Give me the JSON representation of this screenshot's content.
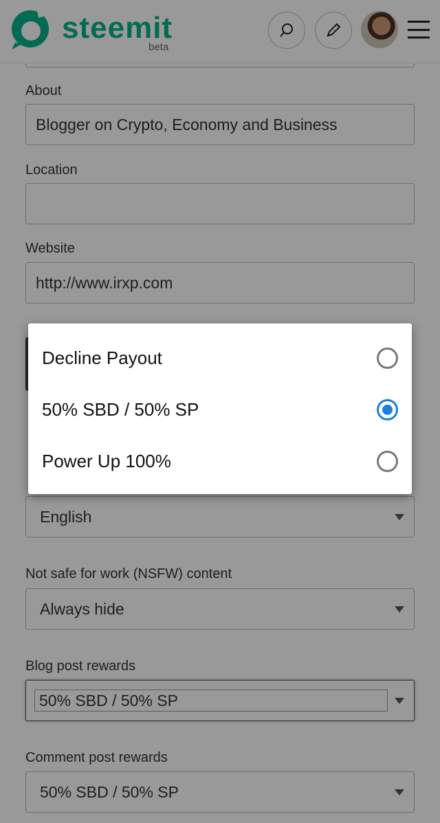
{
  "header": {
    "brand": "steemit",
    "beta": "beta",
    "search_icon": "search-icon",
    "edit_icon": "pencil-icon",
    "menu_icon": "hamburger-icon",
    "brand_color": "#06b38a"
  },
  "form": {
    "about": {
      "label": "About",
      "value": "Blogger on Crypto, Economy and Business"
    },
    "location": {
      "label": "Location",
      "value": ""
    },
    "website": {
      "label": "Website",
      "value": "http://www.irxp.com"
    },
    "language": {
      "value": "English"
    },
    "nsfw": {
      "label": "Not safe for work (NSFW) content",
      "value": "Always hide"
    },
    "blog_rewards": {
      "label": "Blog post rewards",
      "value": "50% SBD / 50% SP"
    },
    "comment_rewards": {
      "label": "Comment post rewards",
      "value": "50% SBD / 50% SP"
    }
  },
  "dialog": {
    "options": [
      {
        "label": "Decline Payout",
        "selected": false
      },
      {
        "label": "50% SBD / 50% SP",
        "selected": true
      },
      {
        "label": "Power Up 100%",
        "selected": false
      }
    ],
    "accent_color": "#1a7fdc"
  }
}
